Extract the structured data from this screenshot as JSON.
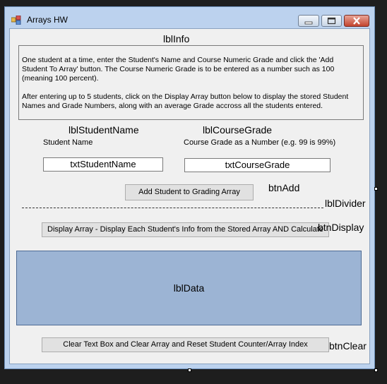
{
  "window": {
    "title": "Arrays HW",
    "controls": [
      "minimize",
      "maximize",
      "close"
    ],
    "icons": {
      "minimize": "minimize-icon",
      "maximize": "maximize-icon",
      "close": "close-icon"
    }
  },
  "lblInfo": {
    "name": "lblInfo",
    "paragraph1": "One student at a time, enter the Student's Name and Course Numeric Grade and click the 'Add Student To Array' button. The Course Numeric Grade is to be entered as a number such as 100 (meaning 100 percent).",
    "paragraph2": "After entering up to 5 students, click on the Display Array button below to display the stored Student Names and Grade Numbers, along with an average Grade accross all the students entered."
  },
  "student": {
    "label_name": "lblStudentName",
    "caption": "Student Name",
    "textbox": "txtStudentName"
  },
  "grade": {
    "label_name": "lblCourseGrade",
    "caption": "Course Grade as a Number (e.g. 99 is 99%)",
    "textbox": "txtCourseGrade"
  },
  "btnAdd": {
    "name": "btnAdd",
    "label": "Add Student to Grading Array"
  },
  "lblDivider": {
    "name": "lblDivider"
  },
  "btnDisplay": {
    "name": "btnDisplay",
    "label": "Display Array - Display Each Student's Info from the Stored Array AND Calculate"
  },
  "lblData": {
    "name": "lblData"
  },
  "btnClear": {
    "name": "btnClear",
    "label": "Clear Text Box and Clear Array and Reset Student Counter/Array Index"
  }
}
